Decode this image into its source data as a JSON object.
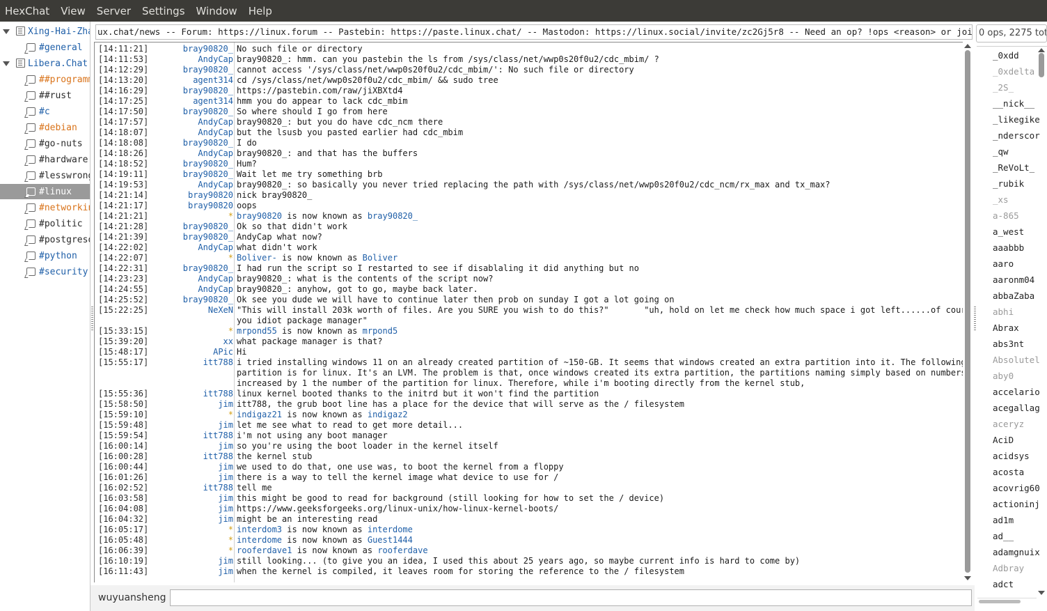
{
  "menu": [
    "HexChat",
    "View",
    "Server",
    "Settings",
    "Window",
    "Help"
  ],
  "tree": [
    {
      "type": "net",
      "label": "Xing-Hai-Zhan",
      "color": "#1f5fa8"
    },
    {
      "type": "chan",
      "label": "#general",
      "color": "#1f5fa8"
    },
    {
      "type": "net",
      "label": "Libera.Chat",
      "color": "#1f5fa8"
    },
    {
      "type": "chan",
      "label": "##programming",
      "color": "#d9731a"
    },
    {
      "type": "chan",
      "label": "##rust",
      "color": "#2b2b2b"
    },
    {
      "type": "chan",
      "label": "#c",
      "color": "#1f5fa8"
    },
    {
      "type": "chan",
      "label": "#debian",
      "color": "#d9731a"
    },
    {
      "type": "chan",
      "label": "#go-nuts",
      "color": "#2b2b2b"
    },
    {
      "type": "chan",
      "label": "#hardware",
      "color": "#2b2b2b"
    },
    {
      "type": "chan",
      "label": "#lesswrong",
      "color": "#2b2b2b"
    },
    {
      "type": "chan",
      "label": "#linux",
      "color": "#ffffff",
      "selected": true
    },
    {
      "type": "chan",
      "label": "#networking",
      "color": "#d9731a"
    },
    {
      "type": "chan",
      "label": "#politic",
      "color": "#2b2b2b"
    },
    {
      "type": "chan",
      "label": "#postgresql",
      "color": "#2b2b2b"
    },
    {
      "type": "chan",
      "label": "#python",
      "color": "#1f5fa8"
    },
    {
      "type": "chan",
      "label": "#security",
      "color": "#1f5fa8"
    }
  ],
  "topic": "ux.chat/news -- Forum: https://linux.forum -- Pastebin: https://paste.linux.chat/ -- Mastodon: https://linux.social/invite/zc2Gj5r8 -- Need an op? !ops <reason> or join #linux-ops",
  "usercount": "0 ops, 2275 total",
  "input_nick": "wuyuansheng",
  "messages": [
    {
      "ts": "[14:11:21]",
      "nick": "bray90820_",
      "text": "No such file or directory"
    },
    {
      "ts": "[14:11:53]",
      "nick": "AndyCap",
      "text": "bray90820_: hmm. can you pastebin the ls from /sys/class/net/wwp0s20f0u2/cdc_mbim/ ?"
    },
    {
      "ts": "[14:12:29]",
      "nick": "bray90820_",
      "text": "cannot access '/sys/class/net/wwp0s20f0u2/cdc_mbim/': No such file or directory"
    },
    {
      "ts": "[14:13:20]",
      "nick": "agent314",
      "text": "cd /sys/class/net/wwp0s20f0u2/cdc_mbim/ && sudo tree"
    },
    {
      "ts": "[14:16:29]",
      "nick": "bray90820_",
      "text": "https://pastebin.com/raw/jiXBXtd4"
    },
    {
      "ts": "[14:17:25]",
      "nick": "agent314",
      "text": "hmm you do appear to lack cdc_mbim"
    },
    {
      "ts": "[14:17:50]",
      "nick": "bray90820_",
      "text": "So where should I go from here"
    },
    {
      "ts": "[14:17:57]",
      "nick": "AndyCap",
      "text": "bray90820_: but you do have cdc_ncm there"
    },
    {
      "ts": "[14:18:07]",
      "nick": "AndyCap",
      "text": "but the lsusb you pasted earlier had cdc_mbim"
    },
    {
      "ts": "[14:18:08]",
      "nick": "bray90820_",
      "text": "I do"
    },
    {
      "ts": "[14:18:26]",
      "nick": "AndyCap",
      "text": "bray90820_: and that has the buffers"
    },
    {
      "ts": "[14:18:52]",
      "nick": "bray90820_",
      "text": "Hum?"
    },
    {
      "ts": "[14:19:11]",
      "nick": "bray90820_",
      "text": "Wait let me try something brb"
    },
    {
      "ts": "[14:19:53]",
      "nick": "AndyCap",
      "text": "bray90820_: so basically you never tried replacing the path with /sys/class/net/wwp0s20f0u2/cdc_ncm/rx_max and tx_max?"
    },
    {
      "ts": "[14:21:14]",
      "nick": "bray90820",
      "text": "nick bray90820_"
    },
    {
      "ts": "[14:21:17]",
      "nick": "bray90820",
      "text": "oops"
    },
    {
      "ts": "[14:21:21]",
      "nick": "*",
      "star": true,
      "old": "bray90820",
      "mid": " is now known as ",
      "new": "bray90820_"
    },
    {
      "ts": "[14:21:28]",
      "nick": "bray90820_",
      "text": "Ok so that didn't work"
    },
    {
      "ts": "[14:21:39]",
      "nick": "bray90820_",
      "text": "AndyCap what now?"
    },
    {
      "ts": "[14:22:02]",
      "nick": "AndyCap",
      "text": "what didn't work"
    },
    {
      "ts": "[14:22:07]",
      "nick": "*",
      "star": true,
      "old": "Boliver-",
      "mid": " is now known as ",
      "new": "Boliver"
    },
    {
      "ts": "[14:22:31]",
      "nick": "bray90820_",
      "text": "I had run the script so I restarted to see if disablaling it did anything but no"
    },
    {
      "ts": "[14:23:23]",
      "nick": "AndyCap",
      "text": "bray90820_: what is the contents of the script now?"
    },
    {
      "ts": "[14:24:55]",
      "nick": "AndyCap",
      "text": "bray90820_: anyhow, got to go, maybe back later."
    },
    {
      "ts": "[14:25:52]",
      "nick": "bray90820_",
      "text": "Ok see you dude we will have to continue later then prob on sunday I got a lot going on"
    },
    {
      "ts": "[15:22:25]",
      "nick": "NeXeN",
      "text": "\"This will install 203k worth of files. Are you SURE you wish to do this?\"       \"uh, hold on let me check how much space i got left......of course"
    },
    {
      "ts": "",
      "nick": "",
      "text": "you idiot package manager\""
    },
    {
      "ts": "[15:33:15]",
      "nick": "*",
      "star": true,
      "old": "mrpond55",
      "mid": " is now known as ",
      "new": "mrpond5"
    },
    {
      "ts": "[15:39:20]",
      "nick": "xx",
      "text": "what package manager is that?"
    },
    {
      "ts": "[15:48:17]",
      "nick": "APic",
      "text": "Hi"
    },
    {
      "ts": "[15:55:17]",
      "nick": "itt788",
      "text": "i tried installing windows 11 on an already created partition of ~150-GB. It seems that windows created an extra partition into it. The following"
    },
    {
      "ts": "",
      "nick": "",
      "text": "partition is for linux. It's an LVM. The problem is that, once windows created its extra partition, the partitions naming simply based on numbers"
    },
    {
      "ts": "",
      "nick": "",
      "text": "increased by 1 the number of the partition for linux. Therefore, while i'm booting directly from the kernel stub,"
    },
    {
      "ts": "[15:55:36]",
      "nick": "itt788",
      "text": "linux kernel booted thanks to the initrd but it won't find the partition"
    },
    {
      "ts": "[15:58:50]",
      "nick": "jim",
      "text": "itt788, the grub boot line has a place for the device that will serve as the / filesystem"
    },
    {
      "ts": "[15:59:10]",
      "nick": "*",
      "star": true,
      "old": "indigaz21",
      "mid": " is now known as ",
      "new": "indigaz2"
    },
    {
      "ts": "[15:59:48]",
      "nick": "jim",
      "text": "let me see what to read to get more detail..."
    },
    {
      "ts": "[15:59:54]",
      "nick": "itt788",
      "text": "i'm not using any boot manager"
    },
    {
      "ts": "[16:00:14]",
      "nick": "jim",
      "text": "so you're using the boot loader in the kernel itself"
    },
    {
      "ts": "[16:00:28]",
      "nick": "itt788",
      "text": "the kernel stub"
    },
    {
      "ts": "[16:00:44]",
      "nick": "jim",
      "text": "we used to do that, one use was, to boot the kernel from a floppy"
    },
    {
      "ts": "[16:01:26]",
      "nick": "jim",
      "text": "there is a way to tell the kernel image what device to use for /"
    },
    {
      "ts": "[16:02:52]",
      "nick": "itt788",
      "text": "tell me"
    },
    {
      "ts": "[16:03:58]",
      "nick": "jim",
      "text": "this might be good to read for background (still looking for how to set the / device)"
    },
    {
      "ts": "[16:04:08]",
      "nick": "jim",
      "text": "https://www.geeksforgeeks.org/linux-unix/how-linux-kernel-boots/"
    },
    {
      "ts": "[16:04:32]",
      "nick": "jim",
      "text": "might be an interesting read"
    },
    {
      "ts": "[16:05:17]",
      "nick": "*",
      "star": true,
      "old": "interdom3",
      "mid": " is now known as ",
      "new": "interdome"
    },
    {
      "ts": "[16:05:48]",
      "nick": "*",
      "star": true,
      "old": "interdome",
      "mid": " is now known as ",
      "new": "Guest1444"
    },
    {
      "ts": "[16:06:39]",
      "nick": "*",
      "star": true,
      "old": "rooferdave1",
      "mid": " is now known as ",
      "new": "rooferdave"
    },
    {
      "ts": "[16:10:19]",
      "nick": "jim",
      "text": "still looking... (to give you an idea, I used this about 25 years ago, so maybe current info is hard to come by)"
    },
    {
      "ts": "[16:11:43]",
      "nick": "jim",
      "text": "when the kernel is compiled, it leaves room for storing the reference to the / filesystem"
    }
  ],
  "users": [
    {
      "name": "_0xdd"
    },
    {
      "name": "_0xdelta",
      "away": true
    },
    {
      "name": "_2S_",
      "away": true
    },
    {
      "name": "__nick__"
    },
    {
      "name": "_likegike"
    },
    {
      "name": "_nderscor"
    },
    {
      "name": "_qw"
    },
    {
      "name": "_ReVoLt_"
    },
    {
      "name": "_rubik"
    },
    {
      "name": "_xs",
      "away": true
    },
    {
      "name": "a-865",
      "away": true
    },
    {
      "name": "a_west"
    },
    {
      "name": "aaabbb"
    },
    {
      "name": "aaro"
    },
    {
      "name": "aaronm04"
    },
    {
      "name": "abbaZaba"
    },
    {
      "name": "abhi",
      "away": true
    },
    {
      "name": "Abrax"
    },
    {
      "name": "abs3nt"
    },
    {
      "name": "Absolutel",
      "away": true
    },
    {
      "name": "aby0",
      "away": true
    },
    {
      "name": "accelario"
    },
    {
      "name": "acegallag"
    },
    {
      "name": "aceryz",
      "away": true
    },
    {
      "name": "AciD"
    },
    {
      "name": "acidsys"
    },
    {
      "name": "acosta"
    },
    {
      "name": "acovrig60"
    },
    {
      "name": "actioninj"
    },
    {
      "name": "ad1m"
    },
    {
      "name": "ad__"
    },
    {
      "name": "adamgnuix"
    },
    {
      "name": "Adbray",
      "away": true
    },
    {
      "name": "adct"
    }
  ]
}
